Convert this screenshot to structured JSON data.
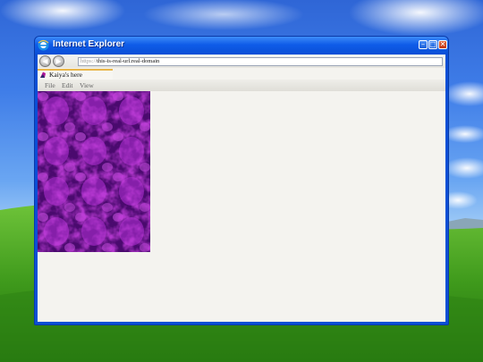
{
  "window": {
    "title": "Internet Explorer",
    "buttons": {
      "minimize": "–",
      "maximize": "□",
      "close": "✕"
    }
  },
  "address_bar": {
    "back_icon": "arrow-left",
    "forward_icon": "arrow-right",
    "url_scheme": "https://",
    "url_host": "this-is-real-url.real-domain"
  },
  "tab": {
    "title": "Kaiya's here"
  },
  "menu": {
    "items": [
      {
        "label": "File"
      },
      {
        "label": "Edit"
      },
      {
        "label": "View"
      }
    ]
  },
  "colors": {
    "titlebar": "#0f5ce8",
    "page_bg": "#f4f3ef",
    "image_purple": "#9a1fc9",
    "close_button": "#c23412"
  }
}
